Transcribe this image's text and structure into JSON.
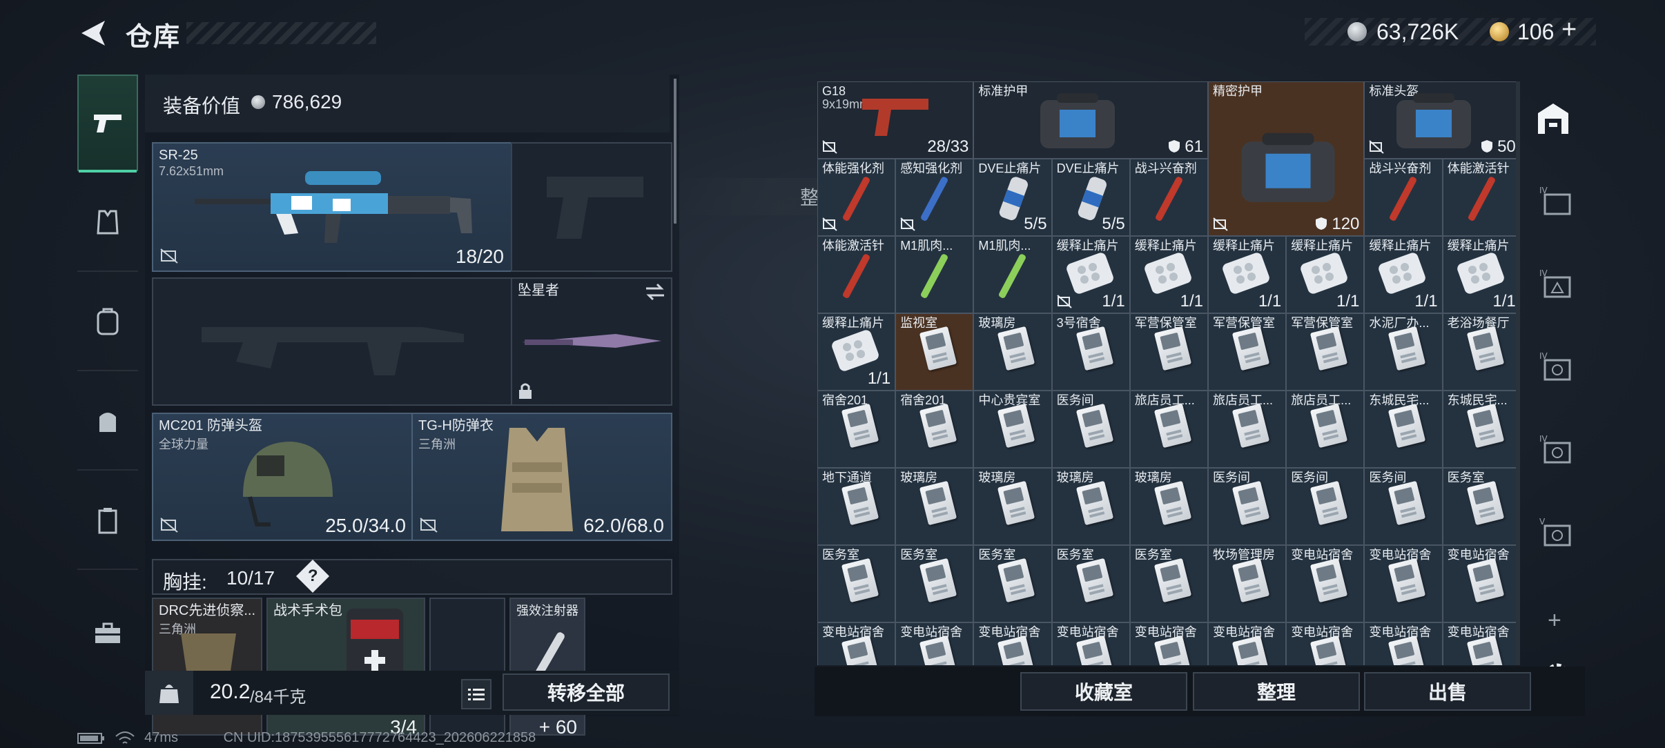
{
  "header": {
    "title": "仓库",
    "silver": "63,726K",
    "gold": "106",
    "add_label": "+"
  },
  "equip": {
    "value_label": "装备价值",
    "value": "786,629",
    "primary": {
      "name": "SR-25",
      "ammo": "7.62x51mm",
      "count": "18/20"
    },
    "melee": {
      "name": "坠星者"
    },
    "helmet": {
      "name": "MC201 防弹头盔",
      "maker": "全球力量",
      "durability": "25.0/34.0"
    },
    "armor": {
      "name": "TG-H防弹衣",
      "maker": "三角洲",
      "durability": "62.0/68.0"
    },
    "rig": {
      "label": "胸挂:",
      "capacity": "10/17",
      "help": "?"
    },
    "rig_items": [
      {
        "name": "DRC先进侦察...",
        "maker": "三角洲"
      },
      {
        "name": "战术手术包",
        "count": "3/4"
      },
      {
        "name": "",
        "count": ""
      },
      {
        "name": "强效注射器",
        "count": "+ 60"
      }
    ],
    "weight": "20.2",
    "weight_max": "/84千克",
    "transfer_all": "转移全部"
  },
  "toast": "整理成功",
  "stash_cells": [
    {
      "label": "G18",
      "sub": "9x19mm",
      "count": "28/33",
      "style": "dark"
    },
    {
      "label": "标准护甲",
      "count": "61",
      "style": "dark"
    },
    {
      "label": "精密护甲",
      "count": "120",
      "style": "gold"
    },
    {
      "label": "标准头盔",
      "count": "50",
      "style": "dark"
    },
    {
      "label": "体能强化剂"
    },
    {
      "label": "感知强化剂"
    },
    {
      "label": "DVE止痛片",
      "count": "5/5"
    },
    {
      "label": "DVE止痛片",
      "count": "5/5"
    },
    {
      "label": "战斗兴奋剂"
    },
    {
      "label": "战斗兴奋剂"
    },
    {
      "label": "体能激活针"
    },
    {
      "label": "体能激活针"
    },
    {
      "label": "M1肌肉..."
    },
    {
      "label": "M1肌肉..."
    },
    {
      "label": "缓释止痛片",
      "count": "1/1"
    },
    {
      "label": "缓释止痛片",
      "count": "1/1"
    },
    {
      "label": "缓释止痛片",
      "count": "1/1"
    },
    {
      "label": "缓释止痛片",
      "count": "1/1"
    },
    {
      "label": "缓释止痛片",
      "count": "1/1"
    },
    {
      "label": "缓释止痛片",
      "count": "1/1"
    },
    {
      "label": "缓释止痛片",
      "count": "1/1"
    },
    {
      "label": "监视室",
      "style": "gold"
    },
    {
      "label": "玻璃房"
    },
    {
      "label": "3号宿舍"
    },
    {
      "label": "军营保管室"
    },
    {
      "label": "军营保管室"
    },
    {
      "label": "军营保管室"
    },
    {
      "label": "水泥厂办..."
    },
    {
      "label": "老浴场餐厅"
    },
    {
      "label": "宿舍201"
    },
    {
      "label": "宿舍201"
    },
    {
      "label": "中心贵宾室"
    },
    {
      "label": "医务间"
    },
    {
      "label": "旅店员工..."
    },
    {
      "label": "旅店员工..."
    },
    {
      "label": "旅店员工..."
    },
    {
      "label": "东城民宅..."
    },
    {
      "label": "东城民宅..."
    },
    {
      "label": "地下通道"
    },
    {
      "label": "玻璃房"
    },
    {
      "label": "玻璃房"
    },
    {
      "label": "玻璃房"
    },
    {
      "label": "玻璃房"
    },
    {
      "label": "医务间"
    },
    {
      "label": "医务间"
    },
    {
      "label": "医务间"
    },
    {
      "label": "医务室"
    },
    {
      "label": "医务室"
    },
    {
      "label": "医务室"
    },
    {
      "label": "医务室"
    },
    {
      "label": "医务室"
    },
    {
      "label": "医务室"
    },
    {
      "label": "牧场管理房"
    },
    {
      "label": "变电站宿舍"
    },
    {
      "label": "变电站宿舍"
    },
    {
      "label": "变电站宿舍"
    },
    {
      "label": "变电站宿舍"
    },
    {
      "label": "变电站宿舍"
    },
    {
      "label": "变电站宿舍"
    },
    {
      "label": "变电站宿舍"
    },
    {
      "label": "变电站宿舍"
    },
    {
      "label": "变电站宿舍"
    },
    {
      "label": "变电站宿舍"
    },
    {
      "label": "变电站宿舍"
    },
    {
      "label": "变电站宿舍"
    }
  ],
  "bottom_buttons": {
    "collection": "收藏室",
    "organize": "整理",
    "sell": "出售"
  },
  "right_add": "+",
  "status": {
    "ping": "47ms",
    "uid": "CN UID:18753955561777276442​3_202606221858"
  }
}
